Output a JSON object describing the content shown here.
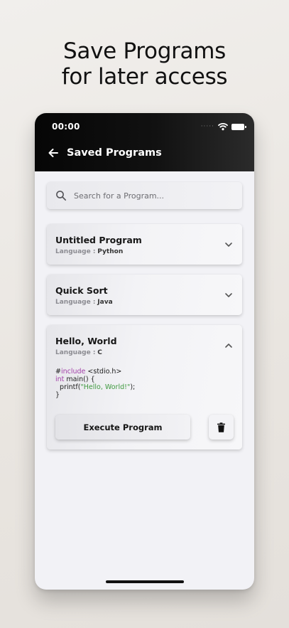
{
  "headline": {
    "line1": "Save Programs",
    "line2": "for later access"
  },
  "status_bar": {
    "time": "00:00",
    "signal_dots": "·····",
    "icons": [
      "wifi-icon",
      "battery-icon"
    ]
  },
  "header": {
    "back_icon": "arrow-left-icon",
    "title": "Saved Programs"
  },
  "search": {
    "icon": "search-icon",
    "placeholder": "Search for a Program..."
  },
  "language_label": "Language :",
  "programs": [
    {
      "title": "Untitled Program",
      "language": "Python",
      "expanded": false
    },
    {
      "title": "Quick Sort",
      "language": "Java",
      "expanded": false
    },
    {
      "title": "Hello, World",
      "language": "C",
      "expanded": true,
      "code": {
        "l1_hash": "#",
        "l1_kw": "include",
        "l1_rest": " <stdio.h>",
        "l2_kw": "int",
        "l2_rest": " main() {",
        "l3_pre": "  printf(",
        "l3_str": "\"Hello, World!\"",
        "l3_post": ");",
        "l4": "}"
      },
      "execute_label": "Execute Program",
      "delete_icon": "trash-icon"
    }
  ],
  "colors": {
    "header_bg": "#0a0a0a",
    "screen_bg": "#f2f2f6",
    "keyword": "#a240a8",
    "string": "#3f9a3f"
  }
}
